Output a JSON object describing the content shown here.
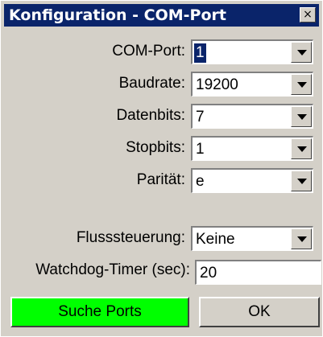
{
  "window": {
    "title": "Konfiguration - COM-Port",
    "close_icon": "close-icon",
    "close_glyph": "×"
  },
  "fields": {
    "com_port": {
      "label": "COM-Port:",
      "value": "1"
    },
    "baudrate": {
      "label": "Baudrate:",
      "value": "19200"
    },
    "datenbits": {
      "label": "Datenbits:",
      "value": "7"
    },
    "stopbits": {
      "label": "Stopbits:",
      "value": "1"
    },
    "paritaet": {
      "label": "Parität:",
      "value": "e"
    },
    "flusssteuerung": {
      "label": "Flusssteuerung:",
      "value": "Keine"
    },
    "watchdog": {
      "label": "Watchdog-Timer (sec):",
      "value": "20"
    }
  },
  "buttons": {
    "search": "Suche Ports",
    "ok": "OK"
  },
  "colors": {
    "titlebar": "#0a246a",
    "dialog": "#d4d0c8",
    "search_button": "#00ff00"
  }
}
